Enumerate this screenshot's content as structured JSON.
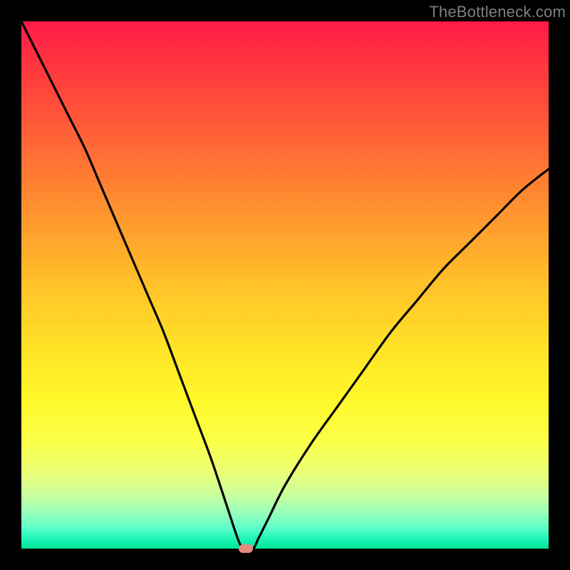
{
  "watermark": "TheBottleneck.com",
  "colors": {
    "frame": "#000000",
    "watermark": "#7f7f7f",
    "curve": "#000000",
    "marker": "#e88a82"
  },
  "chart_data": {
    "type": "line",
    "title": "",
    "xlabel": "",
    "ylabel": "",
    "xlim": [
      0,
      100
    ],
    "ylim": [
      0,
      100
    ],
    "series": [
      {
        "name": "bottleneck-curve",
        "x": [
          0,
          3,
          6,
          9,
          12,
          15,
          18,
          21,
          24,
          27,
          30,
          33,
          36,
          39,
          41,
          42,
          43,
          44,
          45,
          47,
          50,
          55,
          60,
          65,
          70,
          75,
          80,
          85,
          90,
          95,
          100
        ],
        "values": [
          100,
          94,
          88,
          82,
          76,
          69,
          62,
          55,
          48,
          41,
          33,
          25,
          17,
          8,
          2,
          0,
          0,
          0,
          2,
          6,
          12,
          20,
          27,
          34,
          41,
          47,
          53,
          58,
          63,
          68,
          72
        ]
      }
    ],
    "marker": {
      "x": 42.5,
      "y": 0
    },
    "gradient_stops": [
      {
        "pos": 0,
        "color": "#ff1a49"
      },
      {
        "pos": 50,
        "color": "#ffc229"
      },
      {
        "pos": 80,
        "color": "#faff4a"
      },
      {
        "pos": 100,
        "color": "#00e59a"
      }
    ]
  }
}
